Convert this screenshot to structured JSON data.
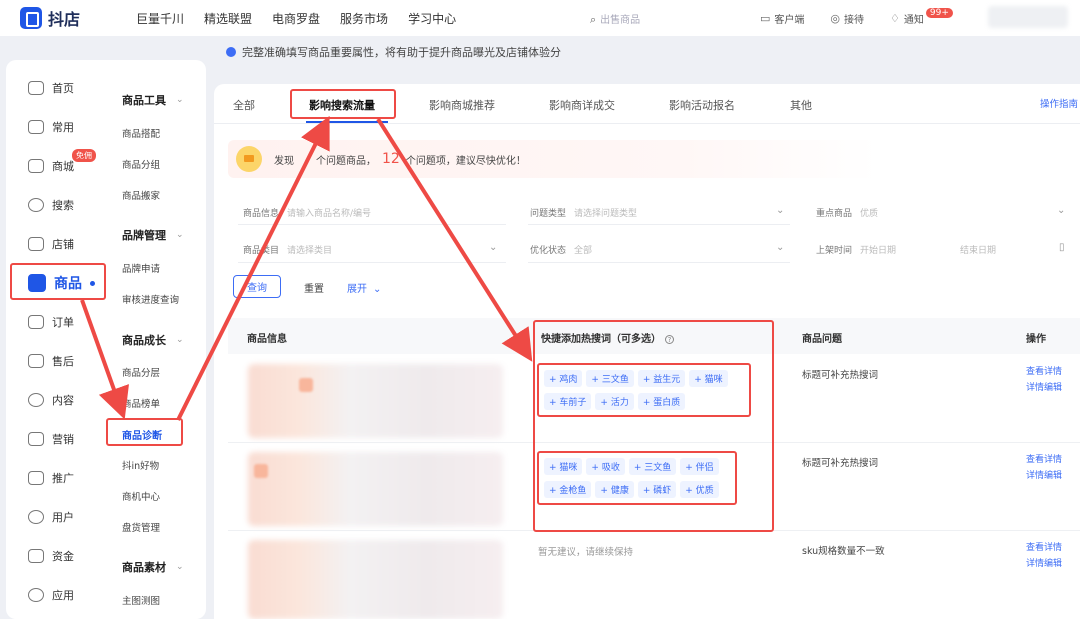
{
  "app": {
    "logo_text": "抖店"
  },
  "topnav": [
    "巨量千川",
    "精选联盟",
    "电商罗盘",
    "服务市场",
    "学习中心"
  ],
  "top_search_placeholder": "出售商品",
  "top_right": {
    "service": "客户端",
    "help": "接待",
    "notify": "通知",
    "notify_badge": "99+"
  },
  "notice": "完整准确填写商品重要属性，将有助于提升商品曝光及店铺体验分",
  "sidebar": {
    "main_items": [
      {
        "label": "首页",
        "icon": "home-icon"
      },
      {
        "label": "常用",
        "icon": "folder-icon"
      },
      {
        "label": "商城",
        "icon": "shop-icon",
        "badge": "免佣"
      },
      {
        "label": "搜索",
        "icon": "search-icon"
      },
      {
        "label": "店铺",
        "icon": "store-icon"
      },
      {
        "label": "商品",
        "icon": "goods-icon",
        "active": true
      },
      {
        "label": "订单",
        "icon": "order-icon"
      },
      {
        "label": "售后",
        "icon": "aftersale-icon"
      },
      {
        "label": "内容",
        "icon": "content-icon"
      },
      {
        "label": "营销",
        "icon": "megaphone-icon"
      },
      {
        "label": "推广",
        "icon": "promote-icon"
      },
      {
        "label": "用户",
        "icon": "user-icon"
      },
      {
        "label": "资金",
        "icon": "wallet-icon"
      },
      {
        "label": "应用",
        "icon": "app-icon"
      }
    ],
    "groups": [
      {
        "title": "商品工具",
        "items": [
          "商品搭配",
          "商品分组",
          "商品搬家"
        ]
      },
      {
        "title": "品牌管理",
        "items": [
          "品牌申请",
          "审核进度查询"
        ]
      },
      {
        "title": "商品成长",
        "items": [
          "商品分层",
          "商品榜单",
          "商品诊断",
          "抖in好物",
          "商机中心",
          "盘货管理"
        ]
      },
      {
        "title": "商品素材",
        "items": [
          "主图测图"
        ]
      }
    ],
    "active_sub": "商品诊断"
  },
  "tabs": [
    "全部",
    "影响搜索流量",
    "影响商城推荐",
    "影响商详成交",
    "影响活动报名",
    "其他"
  ],
  "active_tab": "影响搜索流量",
  "guide_link": "操作指南",
  "alert": {
    "prefix": "发现",
    "mid": "个问题商品，",
    "count": "12",
    "suffix": "个问题项，建议尽快优化！"
  },
  "filters": {
    "product_info": {
      "label": "商品信息",
      "placeholder": "请输入商品名称/编号"
    },
    "problem_type": {
      "label": "问题类型",
      "placeholder": "请选择问题类型"
    },
    "key_product": {
      "label": "重点商品",
      "placeholder": "优质"
    },
    "category": {
      "label": "商品类目",
      "placeholder": "请选择类目"
    },
    "opt_status": {
      "label": "优化状态",
      "placeholder": "全部"
    },
    "list_time": {
      "label": "上架时间",
      "placeholder_start": "开始日期",
      "placeholder_end": "结束日期"
    }
  },
  "buttons": {
    "query": "查询",
    "reset": "重置",
    "expand": "展开"
  },
  "table": {
    "headers": {
      "info": "商品信息",
      "hotwords": "快捷添加热搜词（可多选）",
      "problem": "商品问题",
      "action": "操作"
    },
    "rows": [
      {
        "chips": [
          "鸡肉",
          "三文鱼",
          "益生元",
          "猫咪",
          "车前子",
          "活力",
          "蛋白质"
        ],
        "problem": "标题可补充热搜词",
        "ops": [
          "查看详情",
          "详情编辑"
        ]
      },
      {
        "chips": [
          "猫咪",
          "吸收",
          "三文鱼",
          "伴侣",
          "金枪鱼",
          "健康",
          "磷虾",
          "优质"
        ],
        "problem": "标题可补充热搜词",
        "ops": [
          "查看详情",
          "详情编辑"
        ]
      },
      {
        "chips": [],
        "note": "暂无建议，请继续保持",
        "problem": "sku规格数量不一致",
        "ops": [
          "查看详情",
          "详情编辑"
        ]
      }
    ]
  }
}
